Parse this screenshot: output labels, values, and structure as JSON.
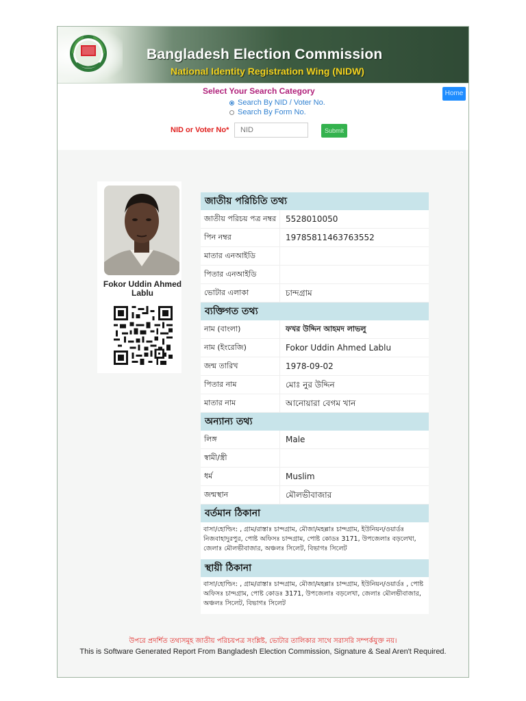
{
  "header": {
    "title": "Bangladesh Election Commission",
    "subtitle": "National Identity Registration Wing (NIDW)"
  },
  "search": {
    "heading": "Select Your Search Category",
    "options": [
      {
        "label": "Search By NID / Voter No.",
        "selected": true
      },
      {
        "label": "Search By Form No.",
        "selected": false
      }
    ],
    "field_label": "NID or Voter No*",
    "placeholder": "NID",
    "submit_label": "Submit",
    "home_label": "Home"
  },
  "person": {
    "name_en": "Fokor Uddin Ahmed Lablu"
  },
  "sections": {
    "national": {
      "heading": "জাতীয় পরিচিতি তথ্য",
      "rows": [
        {
          "key": "জাতীয় পরিচয় পত্র নম্বর",
          "value": "5528010050"
        },
        {
          "key": "পিন নম্বর",
          "value": "19785811463763552"
        },
        {
          "key": "মাতার এনআইডি",
          "value": ""
        },
        {
          "key": "পিতার এনআইডি",
          "value": ""
        },
        {
          "key": "ভোটার এলাকা",
          "value": "চান্দগ্রাম"
        }
      ]
    },
    "personal": {
      "heading": "ব্যক্তিগত তথ্য",
      "rows": [
        {
          "key": "নাম (বাংলা)",
          "value": "ফখর উদ্দিন আহমদ লাভলু"
        },
        {
          "key": "নাম (ইংরেজি)",
          "value": "Fokor Uddin Ahmed Lablu"
        },
        {
          "key": "জন্ম তারিখ",
          "value": "1978-09-02"
        },
        {
          "key": "পিতার নাম",
          "value": "মোঃ নুর উদ্দিন"
        },
        {
          "key": "মাতার নাম",
          "value": "আনোয়ারা বেগম খান"
        }
      ]
    },
    "other": {
      "heading": "অন্যান্য তথ্য",
      "rows": [
        {
          "key": "লিঙ্গ",
          "value": "Male"
        },
        {
          "key": "স্বামী/স্ত্রী",
          "value": ""
        },
        {
          "key": "ধর্ম",
          "value": "Muslim"
        },
        {
          "key": "জন্মস্থান",
          "value": "মৌলভীবাজার"
        }
      ]
    },
    "present_address": {
      "heading": "বর্তমান ঠিকানা",
      "text": "বাসা/হোল্ডিং: , গ্রাম/রাস্তাঃ চান্দগ্রাম, মৌজা/মহল্লাঃ চান্দগ্রাম, ইউনিয়ন/ওয়ার্ডঃ নিজবাহাদুরপুর, পোষ্ট অফিসঃ চান্দগ্রাম, পোষ্ট কোডঃ 3171, উপজেলাঃ বড়লেখা, জেলাঃ মৌলভীবাজার, অঞ্চলঃ সিলেট, বিভাগঃ সিলেট"
    },
    "permanent_address": {
      "heading": "স্থায়ী ঠিকানা",
      "text": "বাসা/হোল্ডিং: , গ্রাম/রাস্তাঃ চান্দগ্রাম, মৌজা/মহল্লাঃ চান্দগ্রাম, ইউনিয়ন/ওয়ার্ডঃ , পোষ্ট অফিসঃ চান্দগ্রাম, পোষ্ট কোডঃ 3171, উপজেলাঃ বড়লেখা, জেলাঃ মৌলভীবাজার, অঞ্চলঃ সিলেট, বিভাগঃ সিলেট"
    }
  },
  "footer": {
    "notice_bn": "উপরে প্রদর্শিত তথ্যসমূহ জাতীয় পরিচয়পত্র সংশ্লিষ্ট, ভোটার তালিকার সাথে সরাসরি সম্পর্কযুক্ত নয়।",
    "notice_en": "This is Software Generated Report From Bangladesh Election Commission, Signature & Seal Aren't Required."
  },
  "colors": {
    "banner_green": "#3c5b41",
    "subtitle_yellow": "#f3d21f",
    "section_head": "#c8e4ea",
    "submit_green": "#34b24e",
    "home_blue": "#1e8cff",
    "warning_red": "#e0201e"
  }
}
